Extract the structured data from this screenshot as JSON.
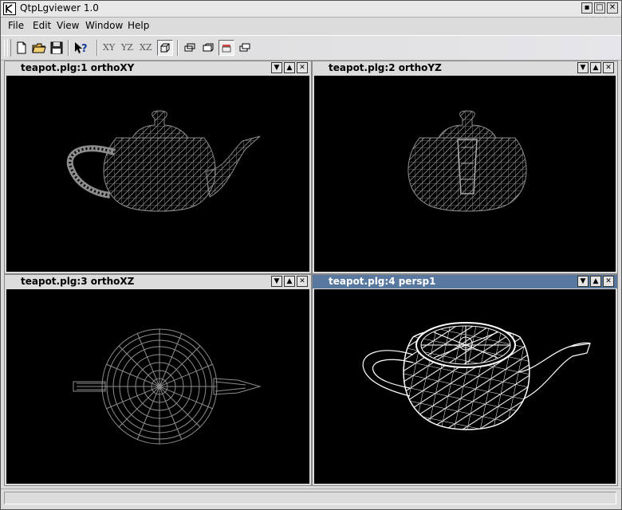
{
  "window": {
    "title": "QtpLgviewer 1.0"
  },
  "menu": [
    "File",
    "Edit",
    "View",
    "Window",
    "Help"
  ],
  "toolbar": {
    "buttons": [
      {
        "name": "new-file-icon"
      },
      {
        "name": "open-folder-icon"
      },
      {
        "name": "save-disk-icon"
      },
      {
        "name": "whats-this-help-icon"
      },
      {
        "label": "XY",
        "name": "view-xy-button"
      },
      {
        "label": "YZ",
        "name": "view-yz-button"
      },
      {
        "label": "XZ",
        "name": "view-xz-button"
      }
    ]
  },
  "subwindows": [
    {
      "title": "teapot.plg:1 orthoXY",
      "active": false
    },
    {
      "title": "teapot.plg:2 orthoYZ",
      "active": false
    },
    {
      "title": "teapot.plg:3 orthoXZ",
      "active": false
    },
    {
      "title": "teapot.plg:4 persp1",
      "active": true
    }
  ],
  "colors": {
    "active_title": "#5878a0",
    "wire_ortho": "#8c8c8c",
    "wire_persp": "#ffffff",
    "viewport_bg": "#000000"
  }
}
